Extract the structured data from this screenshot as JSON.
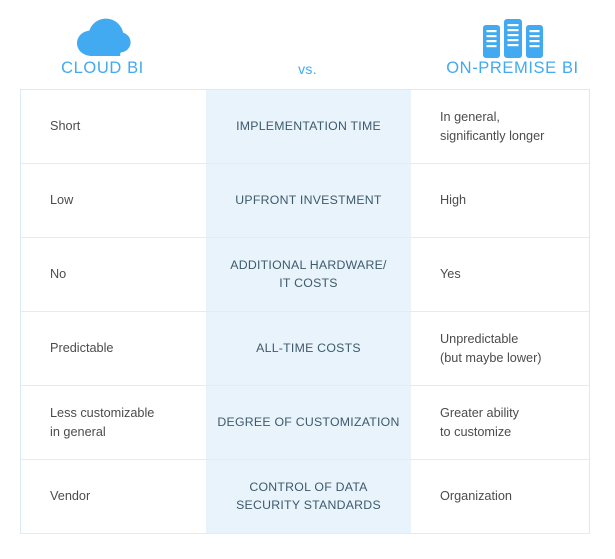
{
  "header": {
    "left": {
      "icon": "cloud-icon",
      "label": "CLOUD BI"
    },
    "center": {
      "label": "vs."
    },
    "right": {
      "icon": "server-racks-icon",
      "label": "ON-PREMISE BI"
    }
  },
  "colors": {
    "accent": "#41aaf0",
    "mid_column_bg": "#e8f3fb",
    "border": "#d8ebf7",
    "body_text": "#4c4c4c",
    "mid_text": "#3e5a6b"
  },
  "table": {
    "rows": [
      {
        "left": "Short",
        "criterion": "IMPLEMENTATION TIME",
        "right": "In general,\nsignificantly longer"
      },
      {
        "left": "Low",
        "criterion": "UPFRONT INVESTMENT",
        "right": "High"
      },
      {
        "left": "No",
        "criterion": "ADDITIONAL HARDWARE/\nIT COSTS",
        "right": "Yes"
      },
      {
        "left": "Predictable",
        "criterion": "ALL-TIME COSTS",
        "right": "Unpredictable\n(but maybe lower)"
      },
      {
        "left": "Less customizable\nin general",
        "criterion": "DEGREE OF CUSTOMIZATION",
        "right": "Greater ability\nto customize"
      },
      {
        "left": "Vendor",
        "criterion": "CONTROL OF DATA\nSECURITY STANDARDS",
        "right": "Organization"
      }
    ]
  }
}
